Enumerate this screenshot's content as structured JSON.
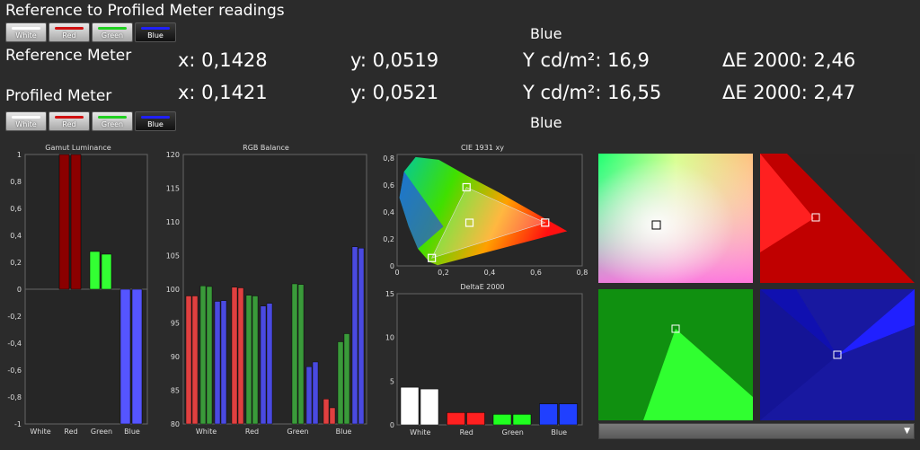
{
  "window_title": "Reference to Profiled Meter readings",
  "buttons": [
    "White",
    "Red",
    "Green",
    "Blue"
  ],
  "button_colors": [
    "#ffffff",
    "#d01010",
    "#20d020",
    "#2020ff"
  ],
  "selected_button": "Blue",
  "reference": {
    "label": "Reference Meter",
    "color_name": "Blue",
    "x": "x: 0,1428",
    "y": "y: 0,0519",
    "Y": "Y cd/m²: 16,9",
    "dE": "ΔE 2000: 2,46"
  },
  "profiled": {
    "label": "Profiled Meter",
    "color_name": "Blue",
    "x": "x: 0,1421",
    "y": "y: 0,0521",
    "Y": "Y cd/m²: 16,55",
    "dE": "ΔE 2000: 2,47"
  },
  "chart_data": [
    {
      "type": "bar",
      "title": "Gamut Luminance",
      "categories": [
        "White",
        "Red",
        "Green",
        "Blue"
      ],
      "series": [
        {
          "values": [
            0,
            1.0,
            0.28,
            -1.0
          ]
        },
        {
          "values": [
            0,
            1.0,
            0.26,
            -1.0
          ]
        }
      ],
      "colors": [
        "#ffffff",
        "#8b0000",
        "#33ff33",
        "#5555ff"
      ],
      "ylim": [
        -1,
        1
      ],
      "yticks": [
        "1",
        "0,8",
        "0,6",
        "0,4",
        "0,2",
        "0",
        "-0,2",
        "-0,4",
        "-0,6",
        "-0,8",
        "-1"
      ]
    },
    {
      "type": "bar",
      "title": "RGB Balance",
      "categories": [
        "White",
        "Red",
        "Green",
        "Blue"
      ],
      "groups": [
        {
          "category": "White",
          "r": [
            99,
            99
          ],
          "g": [
            100.5,
            100.4
          ],
          "b": [
            98.2,
            98.3
          ]
        },
        {
          "category": "Red",
          "r": [
            100.3,
            100.2
          ],
          "g": [
            99.1,
            99.0
          ],
          "b": [
            97.5,
            97.9
          ]
        },
        {
          "category": "Green",
          "r": [
            null,
            null
          ],
          "g": [
            100.8,
            100.7
          ],
          "b": [
            88.5,
            89.2
          ]
        },
        {
          "category": "Blue",
          "r": [
            83.7,
            82.4
          ],
          "g": [
            92.2,
            93.4
          ],
          "b": [
            106.3,
            106.1
          ]
        }
      ],
      "colors": {
        "r": "#e04040",
        "g": "#3a9a3a",
        "b": "#4a4ae0"
      },
      "ylim": [
        80,
        120
      ],
      "yticks": [
        "120",
        "115",
        "110",
        "105",
        "100",
        "95",
        "90",
        "85",
        "80"
      ]
    },
    {
      "type": "scatter",
      "title": "CIE 1931 xy",
      "xlim": [
        0,
        0.8
      ],
      "ylim": [
        0,
        0.85
      ],
      "xticks": [
        "0",
        "0,2",
        "0,4",
        "0,6",
        "0,8"
      ],
      "yticks": [
        "0,8",
        "0,6",
        "0,4",
        "0,2",
        "0"
      ],
      "gamut": [
        [
          0.64,
          0.33
        ],
        [
          0.3,
          0.6
        ],
        [
          0.15,
          0.06
        ]
      ],
      "points": [
        [
          0.64,
          0.33
        ],
        [
          0.3,
          0.6
        ],
        [
          0.15,
          0.06
        ],
        [
          0.3127,
          0.329
        ]
      ]
    },
    {
      "type": "bar",
      "title": "DeltaE 2000",
      "categories": [
        "White",
        "Red",
        "Green",
        "Blue"
      ],
      "series": [
        {
          "values": [
            4.3,
            1.4,
            1.2,
            2.4
          ]
        },
        {
          "values": [
            4.1,
            1.4,
            1.2,
            2.4
          ]
        }
      ],
      "colors": [
        "#ffffff",
        "#ff2020",
        "#20ff20",
        "#2040ff"
      ],
      "ylim": [
        0,
        15
      ],
      "yticks": [
        "15",
        "10",
        "5",
        "0"
      ]
    }
  ]
}
